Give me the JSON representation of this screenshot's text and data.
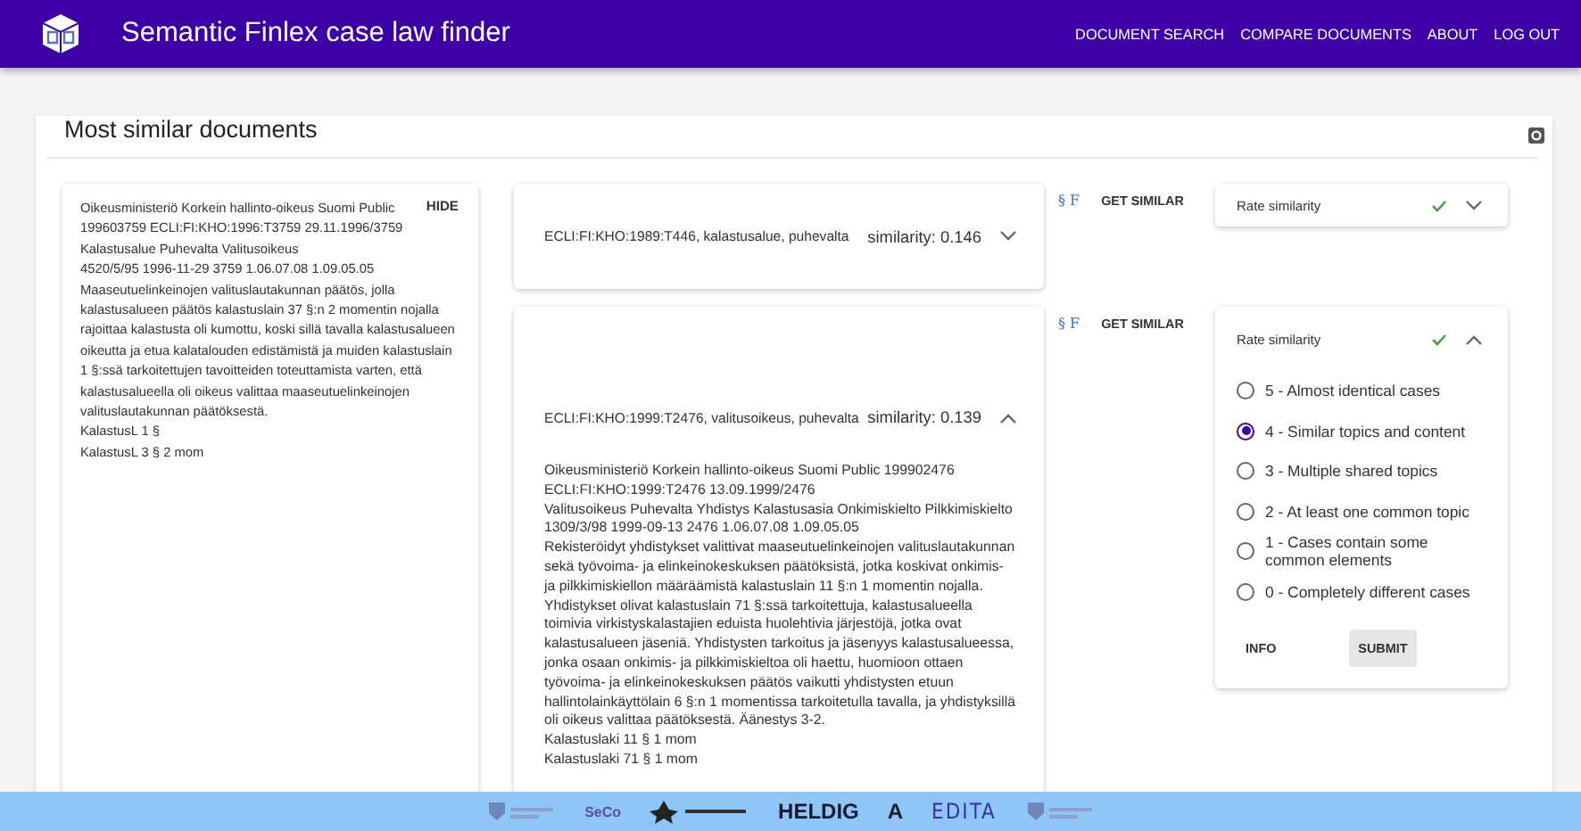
{
  "header": {
    "title": "Semantic Finlex case law finder",
    "nav": [
      "DOCUMENT SEARCH",
      "COMPARE DOCUMENTS",
      "ABOUT",
      "LOG OUT"
    ]
  },
  "page": {
    "title": "Most similar documents"
  },
  "source": {
    "hide_label": "HIDE",
    "paragraphs": [
      "Oikeusministeriö Korkein hallinto-oikeus Suomi Public 199603759 ECLI:FI:KHO:1996:T3759 29.11.1996/3759",
      "Kalastusalue Puhevalta Valitusoikeus",
      "4520/5/95 1996-11-29 3759 1.06.07.08 1.09.05.05",
      "Maaseutuelinkeinojen valituslautakunnan päätös, jolla kalastusalueen päätös kalastuslain 37 §:n 2 momentin nojalla rajoittaa kalastusta oli kumottu, koski sillä tavalla kalastusalueen oikeutta ja etua kalatalouden edistämistä ja muiden kalastuslain 1 §:ssä tarkoitettujen tavoitteiden toteuttamista varten, että kalastusalueella oli oikeus valittaa maaseutuelinkeinojen valituslautakunnan päätöksestä.",
      "KalastusL 1 §",
      "KalastusL 3 § 2 mom"
    ]
  },
  "results": [
    {
      "title": "ECLI:FI:KHO:1989:T446, kalastusalue, puhevalta",
      "similarity": "similarity: 0.146",
      "expanded": false,
      "links": "§ F",
      "action": "GET SIMILAR",
      "rating": {
        "label": "Rate similarity",
        "rated": true,
        "expanded": false
      }
    },
    {
      "title": "ECLI:FI:KHO:1999:T2476, valitusoikeus, puhevalta",
      "similarity": "similarity: 0.139",
      "expanded": true,
      "body": [
        "Oikeusministeriö Korkein hallinto-oikeus Suomi Public 199902476",
        "ECLI:FI:KHO:1999:T2476 13.09.1999/2476",
        "Valitusoikeus Puhevalta Yhdistys Kalastusasia Onkimiskielto Pilkkimiskielto",
        "1309/3/98 1999-09-13 2476 1.06.07.08 1.09.05.05",
        "Rekisteröidyt yhdistykset valittivat maaseutuelinkeinojen valituslautakunnan sekä työvoima- ja elinkeinokeskuksen päätöksistä, jotka koskivat onkimis- ja pilkkimiskiellon määräämistä kalastuslain 11 §:n 1 momentin nojalla. Yhdistykset olivat kalastuslain 71 §:ssä tarkoitettuja, kalastusalueella toimivia virkistyskalastajien eduista huolehtivia järjestöjä, jotka ovat kalastusalueen jäseniä. Yhdistysten tarkoitus ja jäsenyys kalastusalueessa, jonka osaan onkimis- ja pilkkimiskieltoa oli haettu, huomioon ottaen työvoima- ja elinkeinokeskuksen päätös vaikutti yhdistysten etuun hallintolainkäyttölain 6 §:n 1 momentissa tarkoitetulla tavalla, ja yhdistyksillä oli oikeus valittaa päätöksestä. Äänestys 3-2.",
        "Kalastuslaki 11 § 1 mom",
        "Kalastuslaki 71 § 1 mom"
      ],
      "links": "§ F",
      "action": "GET SIMILAR",
      "rating": {
        "label": "Rate similarity",
        "rated": true,
        "expanded": true,
        "options": [
          {
            "label": "5 - Almost identical cases",
            "selected": false
          },
          {
            "label": "4 - Similar topics and content",
            "selected": true
          },
          {
            "label": "3 - Multiple shared topics",
            "selected": false
          },
          {
            "label": "2 - At least one common topic",
            "selected": false
          },
          {
            "label": "1 - Cases contain some common elements",
            "selected": false
          },
          {
            "label": "0 - Completely different cases",
            "selected": false
          }
        ],
        "buttons": [
          "INFO",
          "SUBMIT"
        ]
      }
    }
  ],
  "footer": {
    "logos": [
      {
        "kind": "crest"
      },
      {
        "kind": "mark",
        "text": "SeCo"
      },
      {
        "kind": "emblem"
      },
      {
        "kind": "word",
        "text": "HELDIG"
      },
      {
        "kind": "word",
        "text": "A"
      },
      {
        "kind": "word",
        "text": "EDITA"
      },
      {
        "kind": "crest"
      }
    ]
  }
}
